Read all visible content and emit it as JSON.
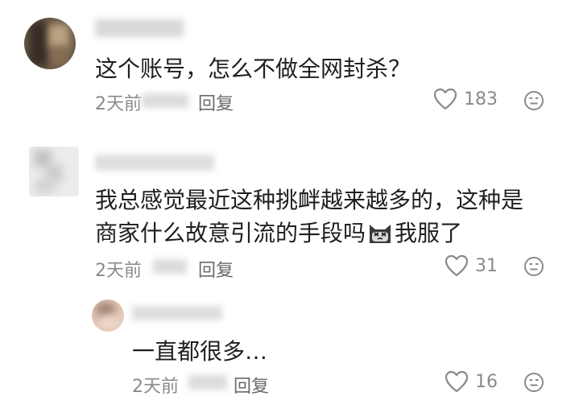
{
  "comments": [
    {
      "text": "这个账号，怎么不做全网封杀？",
      "time": "2天前",
      "reply_label": "回复",
      "likes": "183"
    },
    {
      "text_line1": "我总感觉最近这种挑衅越来越多的，这种是",
      "text_line2a": "商家什么故意引流的手段吗",
      "text_line2b": "我服了",
      "time": "2天前",
      "reply_label": "回复",
      "likes": "31"
    },
    {
      "text": "一直都很多…",
      "time": "2天前",
      "reply_label": "回复",
      "likes": "16"
    }
  ],
  "colors": {
    "meta_gray": "#8a8a8a",
    "text": "#1f1f1f"
  }
}
